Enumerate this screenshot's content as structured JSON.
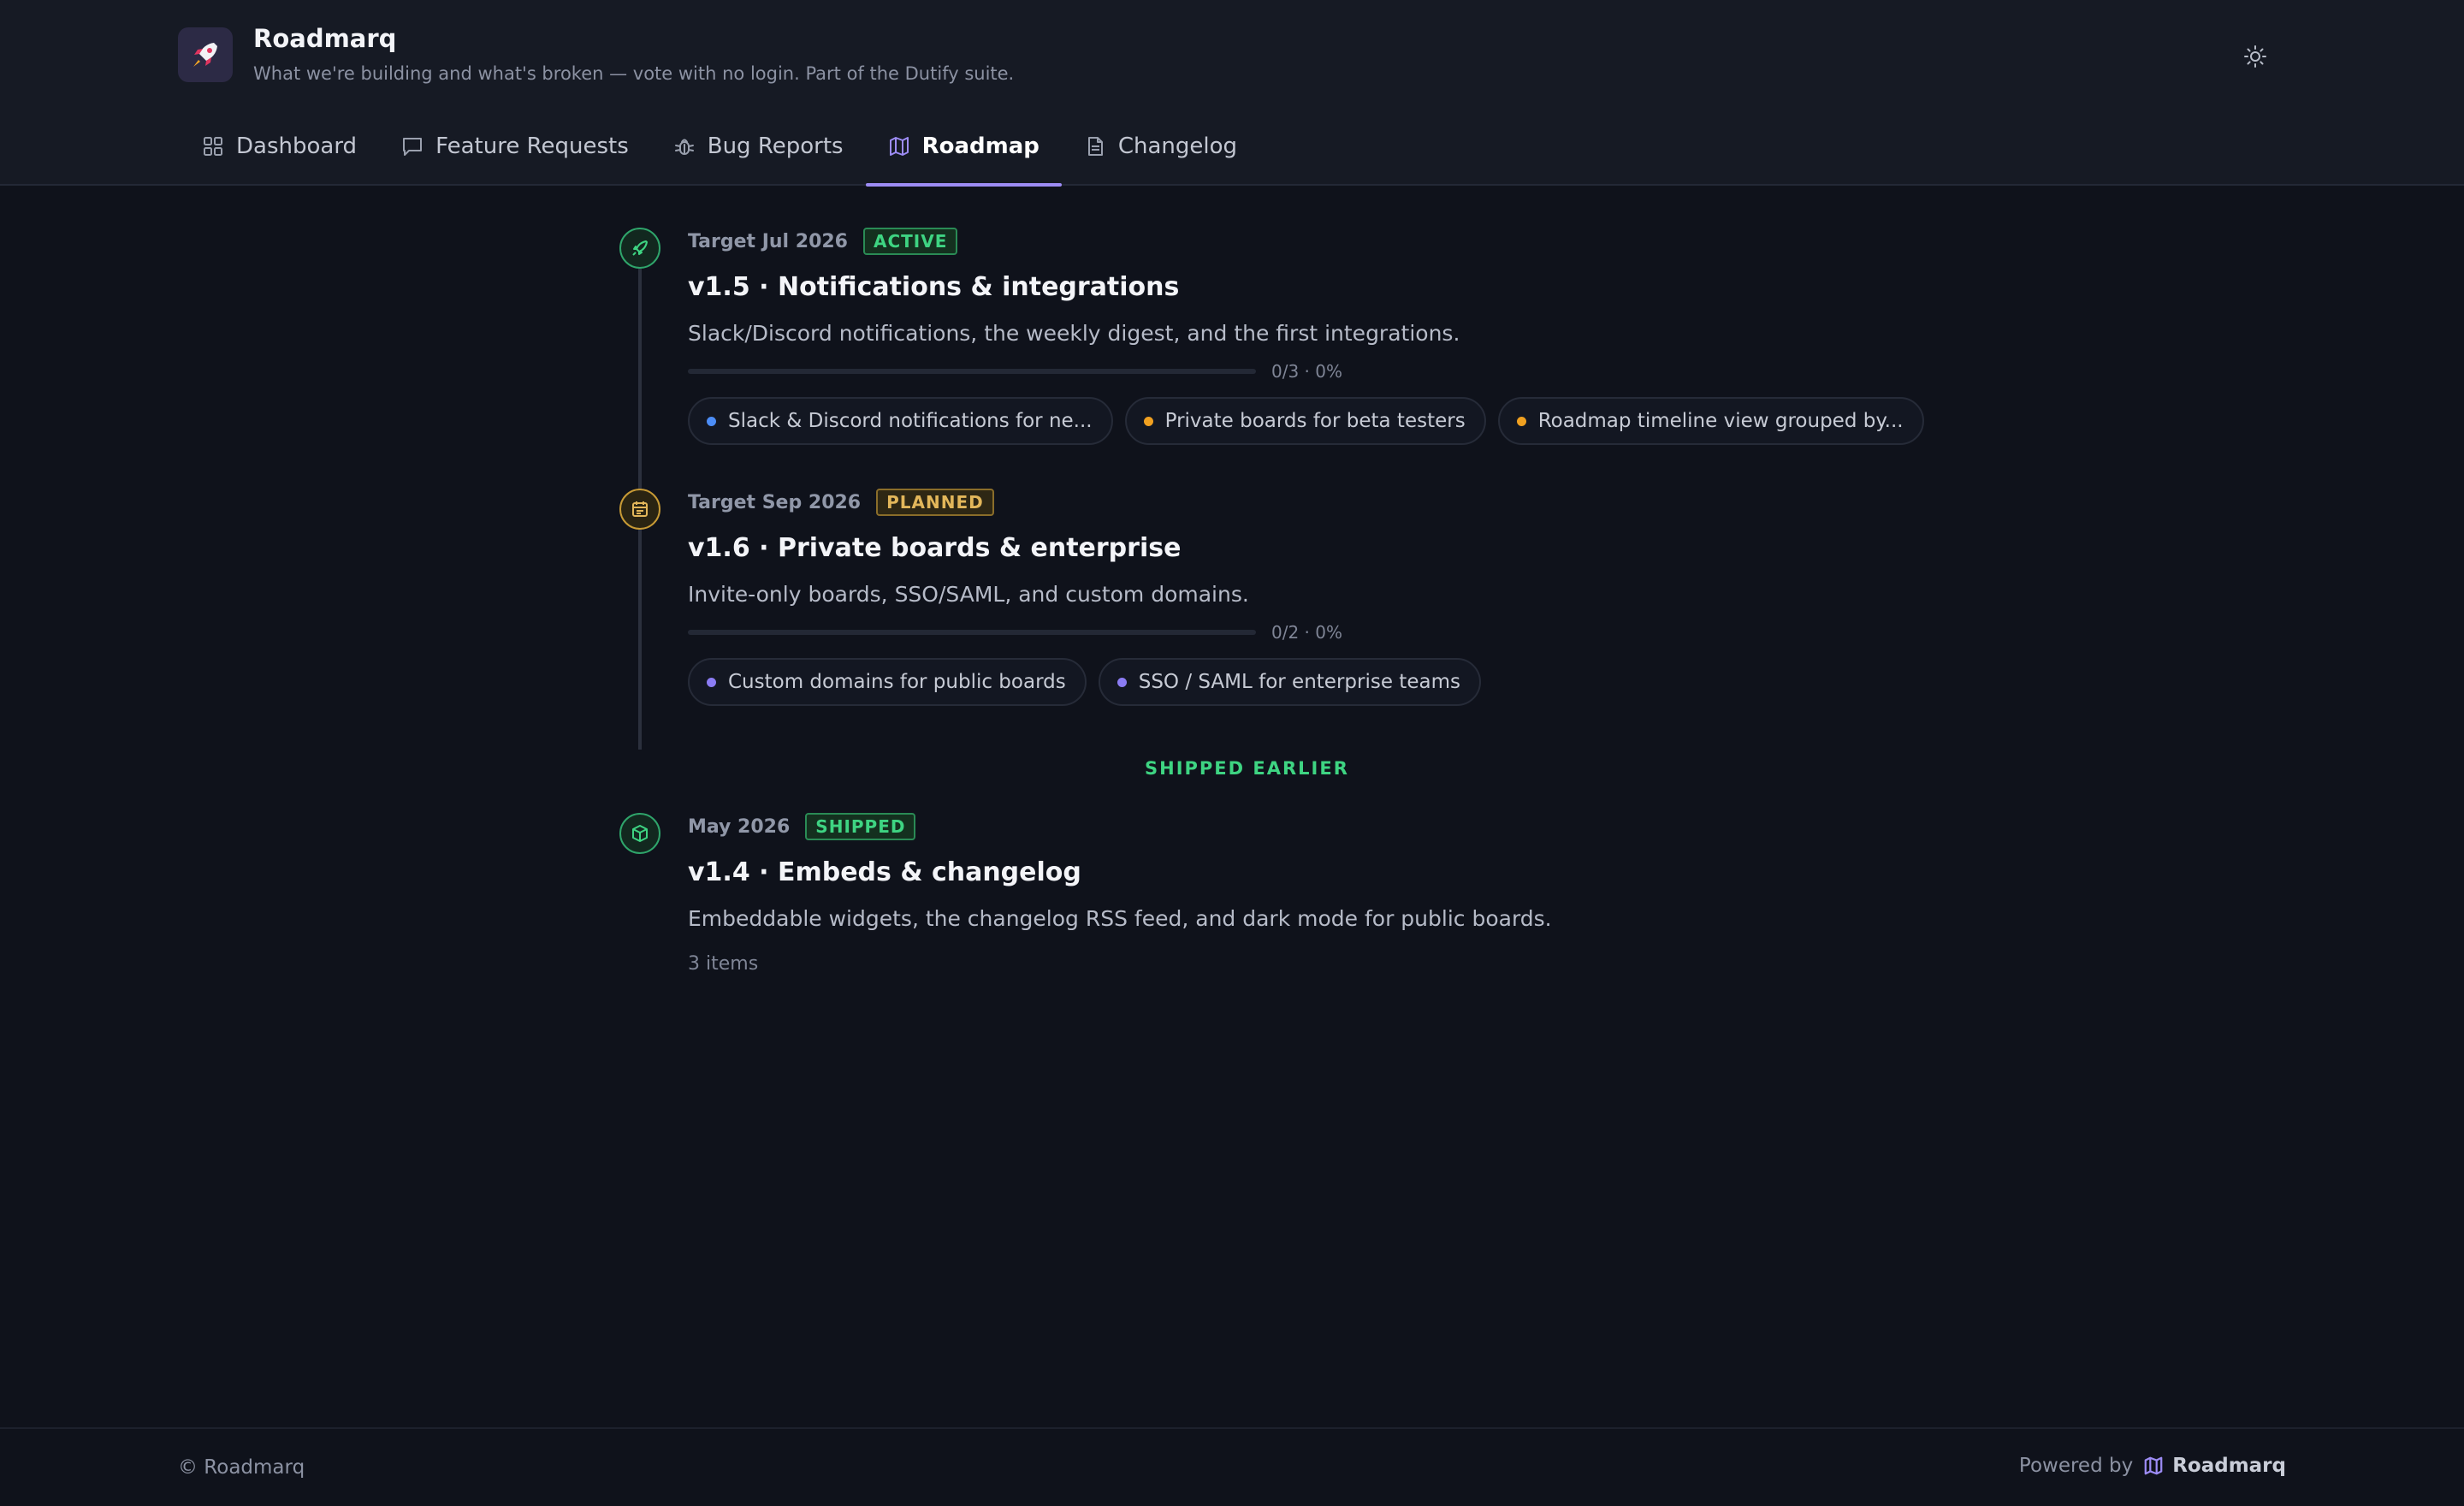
{
  "app": {
    "title": "Roadmarq",
    "subtitle": "What we're building and what's broken — vote with no login. Part of the Dutify suite."
  },
  "nav": {
    "tabs": [
      {
        "label": "Dashboard",
        "icon": "grid-icon",
        "active": false
      },
      {
        "label": "Feature Requests",
        "icon": "chat-icon",
        "active": false
      },
      {
        "label": "Bug Reports",
        "icon": "bug-icon",
        "active": false
      },
      {
        "label": "Roadmap",
        "icon": "map-icon",
        "active": true
      },
      {
        "label": "Changelog",
        "icon": "document-icon",
        "active": false
      }
    ]
  },
  "milestones": [
    {
      "target": "Target Jul 2026",
      "status": "ACTIVE",
      "icon": "rocket-icon",
      "title": "v1.5 · Notifications & integrations",
      "description": "Slack/Discord notifications, the weekly digest, and the first integrations.",
      "progress_text": "0/3 · 0%",
      "progress": 0,
      "items": [
        {
          "label": "Slack & Discord notifications for ne...",
          "dot_color": "#4c8df6"
        },
        {
          "label": "Private boards for beta testers",
          "dot_color": "#f0a020"
        },
        {
          "label": "Roadmap timeline view grouped by...",
          "dot_color": "#f0a020"
        }
      ]
    },
    {
      "target": "Target Sep 2026",
      "status": "PLANNED",
      "icon": "calendar-icon",
      "title": "v1.6 · Private boards & enterprise",
      "description": "Invite-only boards, SSO/SAML, and custom domains.",
      "progress_text": "0/2 · 0%",
      "progress": 0,
      "items": [
        {
          "label": "Custom domains for public boards",
          "dot_color": "#8b7cf3"
        },
        {
          "label": "SSO / SAML for enterprise teams",
          "dot_color": "#8b7cf3"
        }
      ]
    }
  ],
  "shipped_section": {
    "label": "SHIPPED EARLIER",
    "milestone": {
      "target": "May 2026",
      "status": "SHIPPED",
      "icon": "package-icon",
      "title": "v1.4 · Embeds & changelog",
      "description": "Embeddable widgets, the changelog RSS feed, and dark mode for public boards.",
      "items_count": "3 items"
    }
  },
  "footer": {
    "copyright": "© Roadmarq",
    "powered_by": "Powered by",
    "brand": "Roadmarq"
  },
  "colors": {
    "accent": "#9d8cf5",
    "active": "#3ed482",
    "planned": "#e2b65a",
    "background": "#0f121b"
  }
}
